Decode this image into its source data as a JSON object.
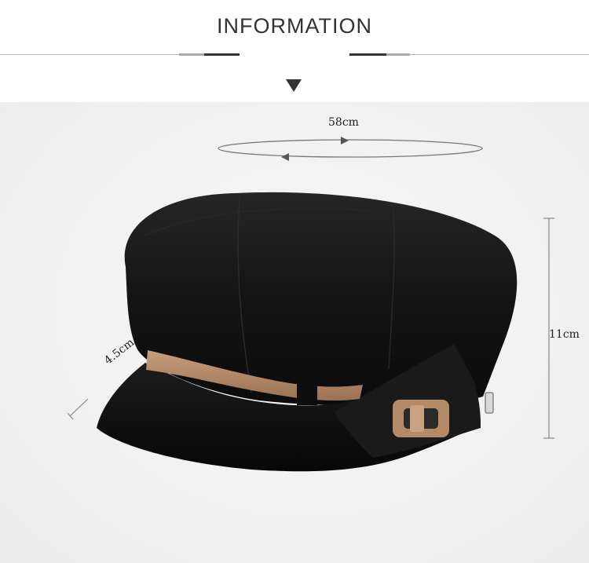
{
  "header": {
    "title": "INFORMATION"
  },
  "measurements": {
    "circumference": "58cm",
    "height": "11cm",
    "brim": "4.5cm"
  },
  "colors": {
    "hat": "#121212",
    "strap": "#b48a67",
    "background": "#f1f1f1"
  }
}
